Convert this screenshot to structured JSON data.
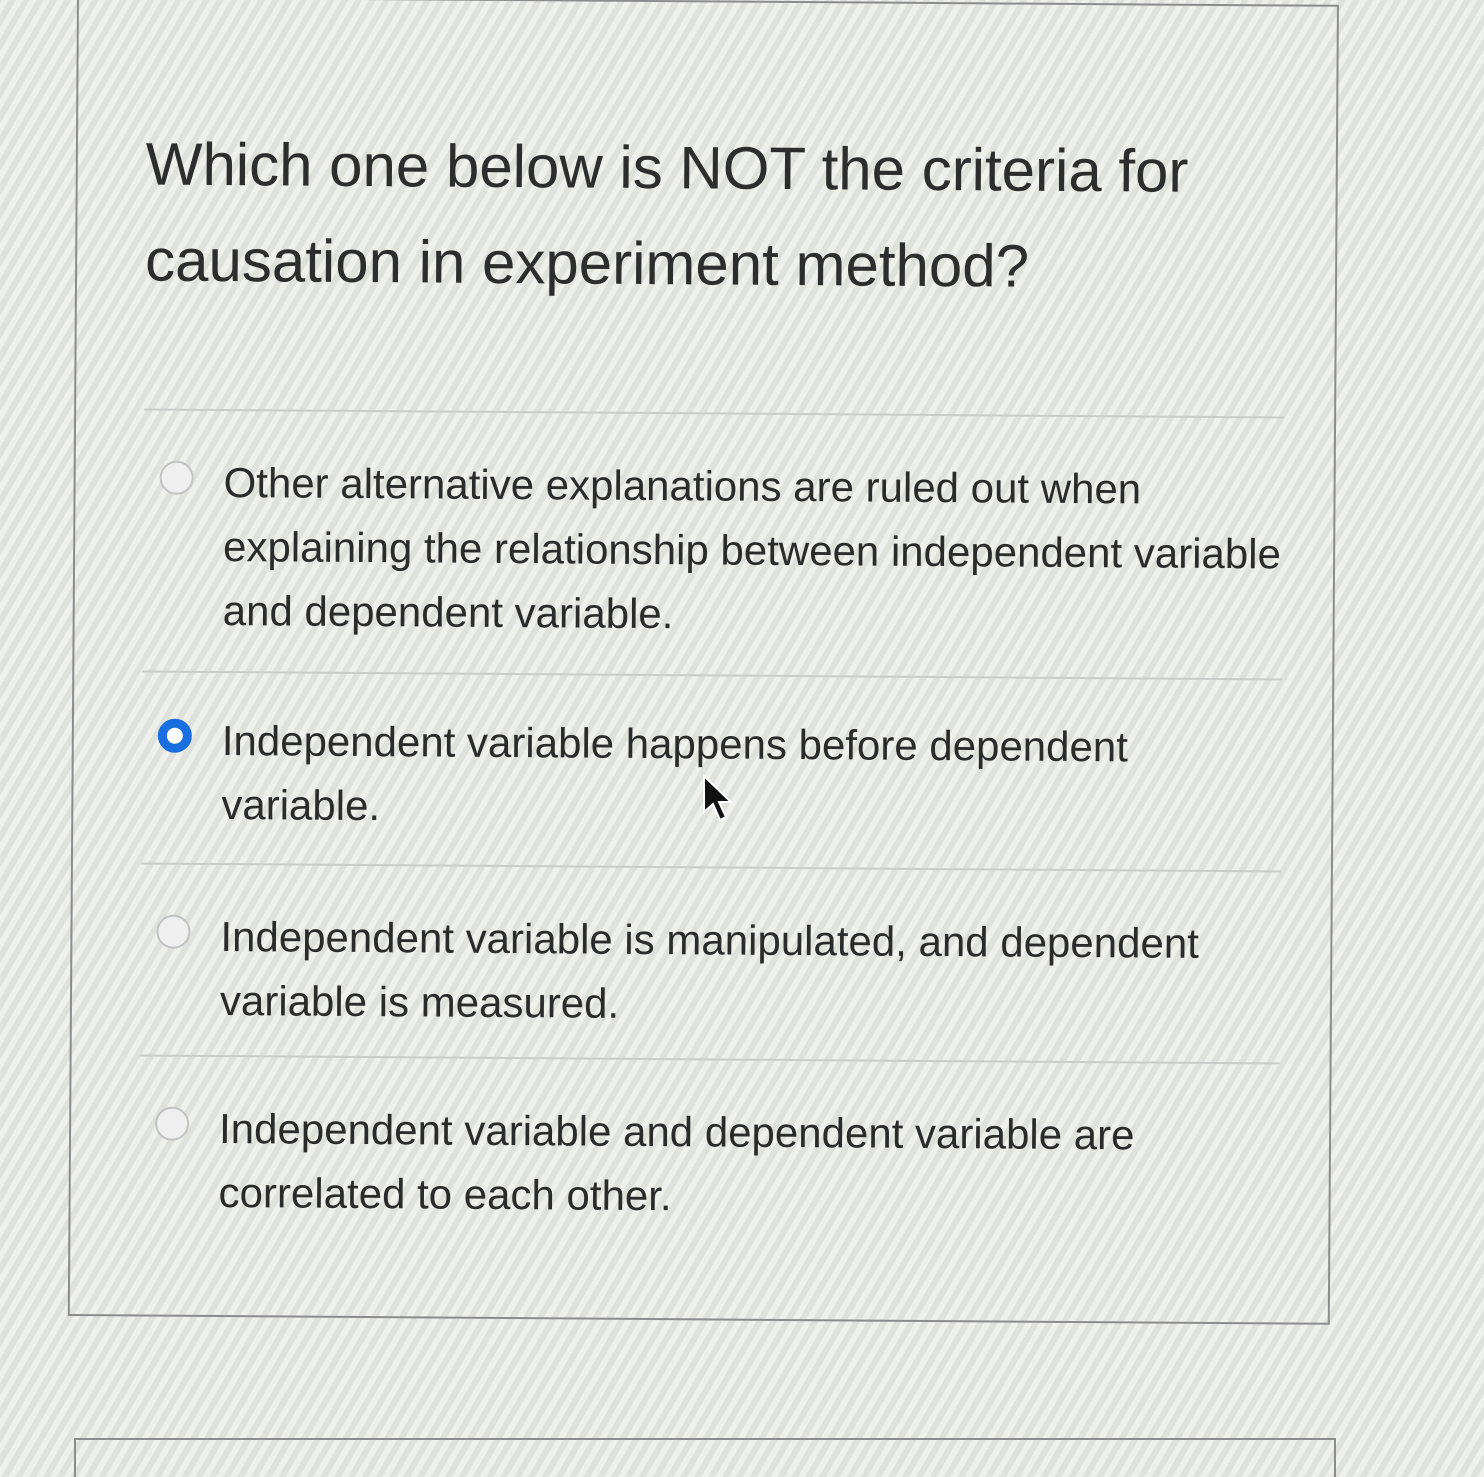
{
  "question": {
    "text": "Which one below is NOT the criteria for causation in experiment method?"
  },
  "answers": [
    {
      "text": "Other alternative explanations are ruled out when explaining the relationship between independent variable and dependent variable.",
      "selected": false
    },
    {
      "text": "Independent variable happens before dependent variable.",
      "selected": true
    },
    {
      "text": "Independent variable is manipulated, and dependent variable is measured.",
      "selected": false
    },
    {
      "text": "Independent variable and dependent variable are correlated to each other.",
      "selected": false
    }
  ],
  "colors": {
    "accent": "#1a6fe0",
    "border": "#8c8c8c",
    "divider": "#c9ccc8"
  },
  "icons": {
    "cursor": "mouse-pointer-icon"
  }
}
